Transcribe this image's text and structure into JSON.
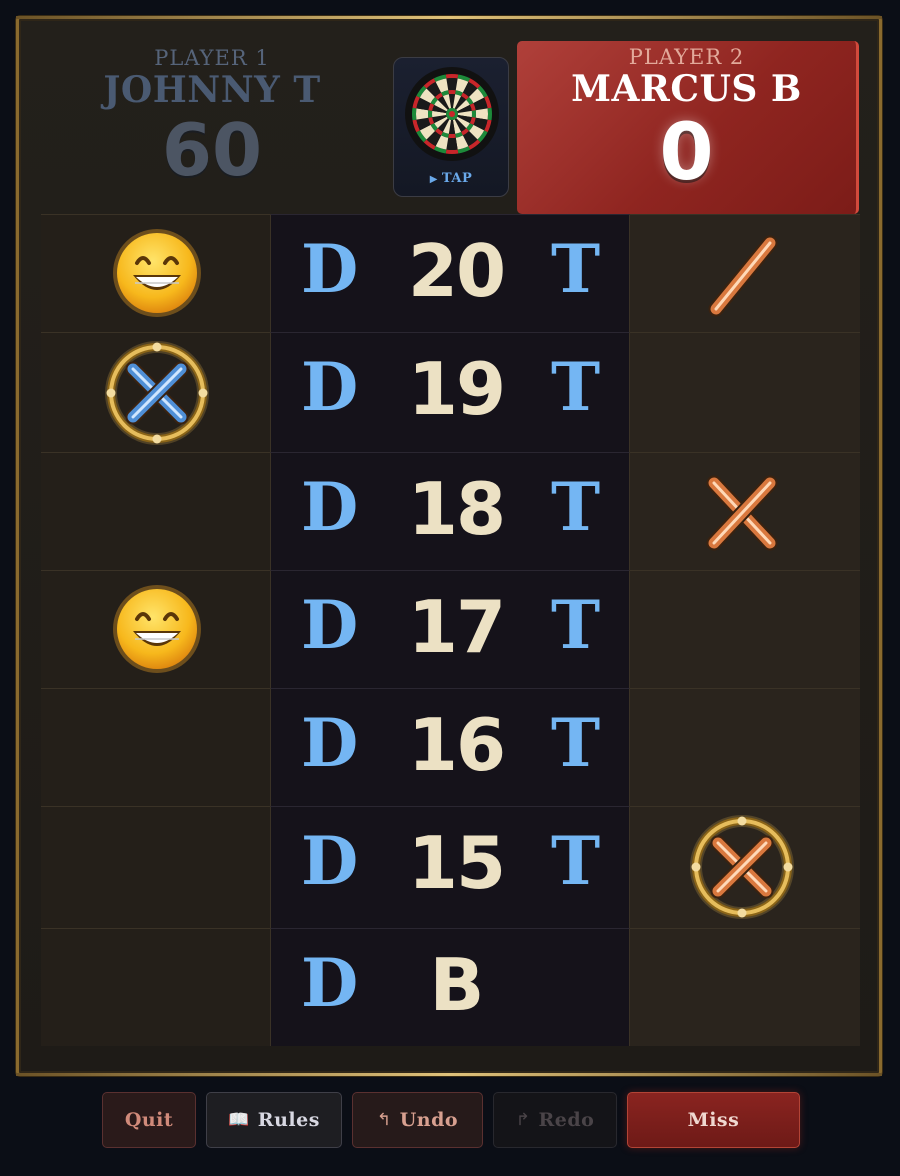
{
  "player1": {
    "label": "PLAYER 1",
    "name": "JOHNNY T",
    "score": "60"
  },
  "player2": {
    "label": "PLAYER 2",
    "name": "MARCUS B",
    "score": "0",
    "active": true
  },
  "dartboard_button": {
    "label": "TAP",
    "icon": "dartboard-icon",
    "arrow_icon": "play-triangle-icon"
  },
  "double_label": "D",
  "triple_label": "T",
  "rows": [
    {
      "number": "20",
      "has_triple": true,
      "p1_mark": "grin",
      "p2_mark": "single-slash"
    },
    {
      "number": "19",
      "has_triple": true,
      "p1_mark": "circled-x",
      "p2_mark": "none"
    },
    {
      "number": "18",
      "has_triple": true,
      "p1_mark": "none",
      "p2_mark": "x"
    },
    {
      "number": "17",
      "has_triple": true,
      "p1_mark": "grin",
      "p2_mark": "none"
    },
    {
      "number": "16",
      "has_triple": true,
      "p1_mark": "none",
      "p2_mark": "none"
    },
    {
      "number": "15",
      "has_triple": true,
      "p1_mark": "none",
      "p2_mark": "circled-x"
    },
    {
      "number": "B",
      "has_triple": false,
      "p1_mark": "none",
      "p2_mark": "none"
    }
  ],
  "footer": {
    "quit": "Quit",
    "rules": "Rules",
    "rules_icon": "book-icon",
    "undo": "Undo",
    "undo_icon": "undo-arrow-icon",
    "redo": "Redo",
    "redo_icon": "redo-arrow-icon",
    "redo_disabled": true,
    "miss": "Miss"
  },
  "colors": {
    "active_player": "#9a2e28",
    "p1_marks": "#74b6f3",
    "p2_marks": "#e08a4e",
    "number_text": "#ece1c4",
    "gold_ring": "#d4a84a"
  }
}
